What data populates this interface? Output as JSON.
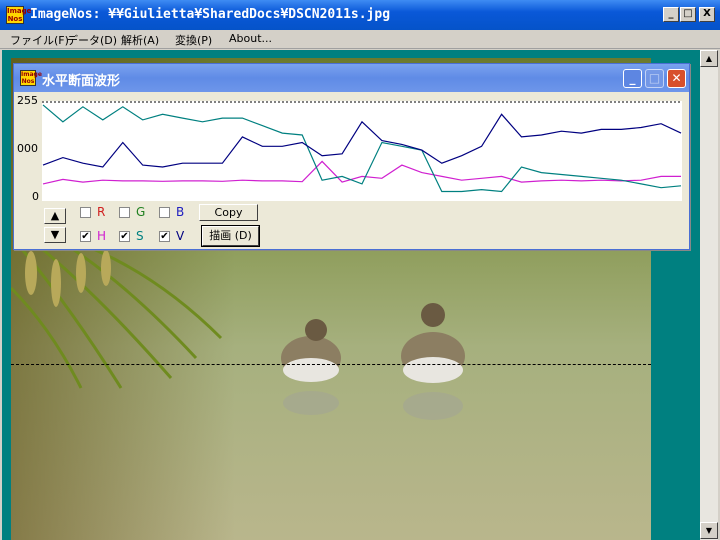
{
  "app": {
    "title": "ImageNos: ¥¥Giulietta¥SharedDocs¥DSCN2011s.jpg",
    "icon_text": "Image Nos"
  },
  "menu": [
    "ファイル(F)",
    "データ(D)",
    "解析(A)",
    "変換(P)",
    "About..."
  ],
  "child": {
    "title": "水平断面波形",
    "y_ticks": [
      "255",
      "000",
      "0"
    ],
    "checkboxes_row1": [
      {
        "label": "R",
        "checked": false,
        "color": "#d02020"
      },
      {
        "label": "G",
        "checked": false,
        "color": "#208020"
      },
      {
        "label": "B",
        "checked": false,
        "color": "#2020c0"
      }
    ],
    "checkboxes_row2": [
      {
        "label": "H",
        "checked": true,
        "color": "#d020d0"
      },
      {
        "label": "S",
        "checked": true,
        "color": "#008080"
      },
      {
        "label": "V",
        "checked": true,
        "color": "#000080"
      }
    ],
    "copy_label": "Copy",
    "draw_label": "描画 (D)",
    "up_arrow": "▲",
    "down_arrow": "▼"
  },
  "window_buttons": {
    "min": "_",
    "max": "□",
    "close": "X"
  },
  "child_buttons": {
    "min": "_",
    "max": "□",
    "close": "✕"
  },
  "chart_data": {
    "type": "line",
    "title": "水平断面波形",
    "ylim": [
      0,
      255
    ],
    "x": [
      0,
      20,
      40,
      60,
      80,
      100,
      120,
      140,
      160,
      180,
      200,
      220,
      240,
      260,
      280,
      300,
      320,
      340,
      360,
      380,
      400,
      420,
      440,
      460,
      480,
      500,
      520,
      540,
      560,
      580,
      600,
      620,
      640
    ],
    "series": [
      {
        "name": "H",
        "color": "#d020d0",
        "values": [
          40,
          52,
          45,
          50,
          48,
          48,
          47,
          48,
          48,
          47,
          50,
          48,
          48,
          46,
          100,
          45,
          60,
          55,
          90,
          70,
          60,
          50,
          55,
          60,
          45,
          48,
          50,
          48,
          50,
          48,
          50,
          60,
          60
        ]
      },
      {
        "name": "S",
        "color": "#008080",
        "values": [
          250,
          205,
          245,
          210,
          245,
          210,
          225,
          215,
          205,
          215,
          215,
          195,
          175,
          170,
          50,
          60,
          40,
          150,
          140,
          130,
          20,
          20,
          25,
          20,
          85,
          70,
          65,
          60,
          55,
          50,
          40,
          30,
          35
        ]
      },
      {
        "name": "V",
        "color": "#000080",
        "values": [
          90,
          110,
          95,
          85,
          150,
          90,
          85,
          95,
          95,
          95,
          165,
          140,
          140,
          150,
          115,
          120,
          205,
          155,
          145,
          130,
          95,
          115,
          140,
          225,
          165,
          170,
          180,
          175,
          185,
          185,
          190,
          200,
          175
        ]
      }
    ]
  }
}
